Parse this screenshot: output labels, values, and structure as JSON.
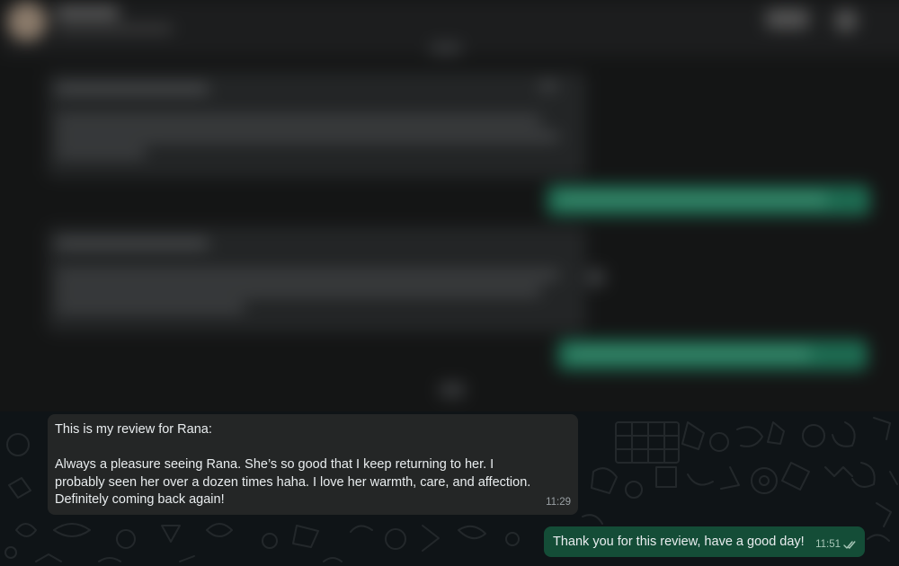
{
  "chat": {
    "incoming": {
      "text": "This is my review for Rana:\n\nAlways a pleasure seeing Rana. She’s so good that I keep returning to her. I probably seen her over a dozen times haha. I love her warmth, care, and affection. Definitely coming back again!",
      "time": "11:29"
    },
    "outgoing": {
      "text": "Thank you for this review, have a good day!",
      "time": "11:51",
      "status_icon": "double-check-icon"
    }
  },
  "colors": {
    "incoming_bubble": "#242626",
    "outgoing_bubble": "#144d37",
    "chat_background": "#0f1417",
    "read_receipt": "#a8c7b8"
  }
}
